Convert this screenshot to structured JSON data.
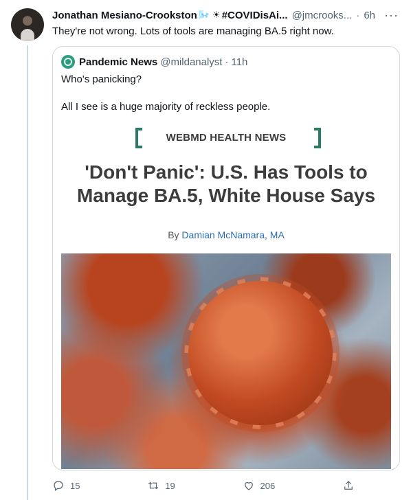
{
  "tweet": {
    "display_name": "Jonathan Mesiano-Crookston",
    "emoji_1": "🌬️",
    "emoji_2": "☀",
    "hashtag_name": "#COVIDisAi...",
    "handle": "@jmcrooks...",
    "dot": "·",
    "time": "6h",
    "text": "They're not wrong. Lots of tools are managing BA.5 right now."
  },
  "quoted": {
    "name": "Pandemic News",
    "handle": "@mildanalyst",
    "dot": "·",
    "time": "11h",
    "text_1": "Who's panicking?",
    "text_2": "All I see is a huge majority of reckless people."
  },
  "article": {
    "brand": "WEBMD HEALTH NEWS",
    "headline_1": "'Don't Panic': U.S. Has Tools to",
    "headline_2": "Manage BA.5, White House Says",
    "by": "By",
    "author": "Damian McNamara, MA"
  },
  "actions": {
    "reply_count": "15",
    "retweet_count": "19",
    "like_count": "206"
  },
  "icons": {
    "reply": "reply-icon",
    "retweet": "retweet-icon",
    "like": "heart-icon",
    "share": "share-icon",
    "more": "more-icon"
  },
  "colors": {
    "accent": "#2a7a66",
    "link": "#2b6cb0",
    "muted": "#536471"
  }
}
